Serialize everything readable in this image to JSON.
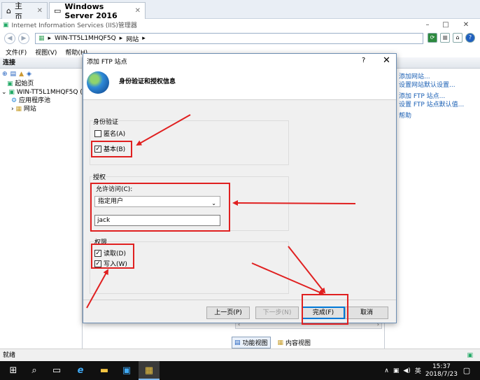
{
  "vm_tabs": [
    {
      "label": "主页",
      "active": false
    },
    {
      "label": "Windows Server 2016",
      "active": true
    }
  ],
  "iis": {
    "title": "Internet Information Services (IIS)管理器",
    "window_controls": [
      "–",
      "□",
      "✕"
    ],
    "address": [
      "WIN-TT5L1MHQF5Q",
      "网站"
    ],
    "menu": [
      "文件(F)",
      "视图(V)",
      "帮助(H)"
    ]
  },
  "left_panel": {
    "heading": "连接",
    "tree": [
      {
        "label": "起始页",
        "indent": 1
      },
      {
        "label": "WIN-TT5L1MHQF5Q (V",
        "indent": 0
      },
      {
        "label": "应用程序池",
        "indent": 2
      },
      {
        "label": "网站",
        "indent": 2
      }
    ]
  },
  "right_panel": {
    "heading": "作",
    "links": [
      "添加网站...",
      "设置网站默认设置...",
      "添加 FTP 站点...",
      "设置 FTP 站点默认值...",
      "帮助"
    ]
  },
  "center": {
    "view_features": "功能视图",
    "view_content": "内容视图"
  },
  "status_text": "就绪",
  "taskbar": {
    "time": "15:37",
    "date": "2018/7/23",
    "ime": "英"
  },
  "dialog": {
    "title": "添加 FTP 站点",
    "help": "?",
    "close": "✕",
    "heading": "身份验证和授权信息",
    "auth_group": "身份验证",
    "anonymous": {
      "label": "匿名(A)",
      "checked": false
    },
    "basic": {
      "label": "基本(B)",
      "checked": true
    },
    "authz_group": "授权",
    "allow_access_label": "允许访问(C):",
    "allow_access_value": "指定用户",
    "user_value": "jack",
    "perm_group": "权限",
    "read": {
      "label": "读取(D)",
      "checked": true
    },
    "write": {
      "label": "写入(W)",
      "checked": true
    },
    "buttons": {
      "prev": "上一页(P)",
      "next": "下一步(N)",
      "finish": "完成(F)",
      "cancel": "取消"
    }
  },
  "annotation_color": "#e02020"
}
